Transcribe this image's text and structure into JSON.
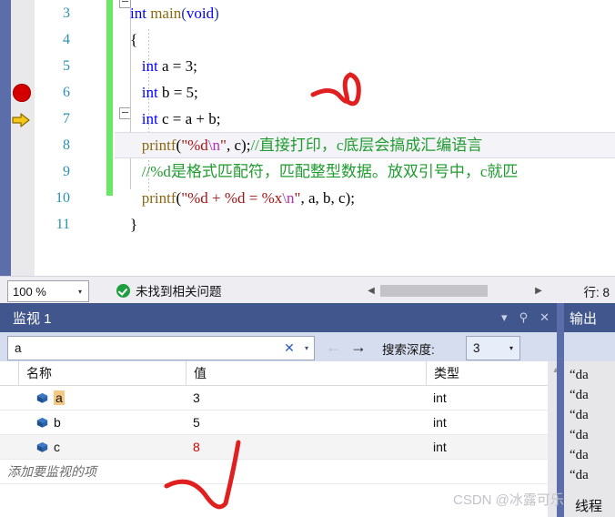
{
  "editor": {
    "line_numbers": [
      "3",
      "4",
      "5",
      "6",
      "7",
      "8",
      "9",
      "10",
      "11"
    ],
    "code_lines": [
      {
        "n": "3",
        "text": "int main(void)"
      },
      {
        "n": "4",
        "text": "{"
      },
      {
        "n": "5",
        "text": "    int a = 3;"
      },
      {
        "n": "6",
        "text": "    int b = 5;"
      },
      {
        "n": "7",
        "text": "    int c = a + b;"
      },
      {
        "n": "8",
        "text": "    printf(\"%d\\n\", c);//直接打印，c底层会搞成汇编语言"
      },
      {
        "n": "9",
        "text": "    //%d是格式匹配符，匹配整型数据。放双引号中，c就匹"
      },
      {
        "n": "10",
        "text": "    printf(\"%d + %d = %x\\n\", a, b, c);"
      },
      {
        "n": "11",
        "text": "}"
      }
    ],
    "breakpoint_line": "7",
    "current_line": "8",
    "colors": {
      "keyword": "#0000ff",
      "function": "#8b6914",
      "string": "#a31515",
      "escape": "#b030b0",
      "comment": "#1f9b2f",
      "linenumber": "#2b91af",
      "changebar": "#67e867",
      "breakpoint": "#d40000"
    }
  },
  "statusbar": {
    "zoom": "100 %",
    "zoom_caret": "▾",
    "problem_status": "未找到相关问题",
    "scroll_left": "◀",
    "scroll_right": "▶",
    "line_indicator": "行: 8"
  },
  "watch": {
    "title": "监视 1",
    "window_buttons": [
      "▾",
      "⚲",
      "✕"
    ],
    "search": {
      "value": "a",
      "clear": "✕",
      "caret": "▾"
    },
    "nav_back": "←",
    "nav_forward": "→",
    "depth_label": "搜索深度:",
    "depth_value": "3",
    "depth_caret": "▾",
    "columns": [
      "名称",
      "值",
      "类型"
    ],
    "rows": [
      {
        "name": "a",
        "value": "3",
        "type": "int",
        "value_changed": false,
        "name_highlight": true
      },
      {
        "name": "b",
        "value": "5",
        "type": "int",
        "value_changed": false,
        "name_highlight": false
      },
      {
        "name": "c",
        "value": "8",
        "type": "int",
        "value_changed": true,
        "name_highlight": false
      }
    ],
    "add_placeholder": "添加要监视的项",
    "scroll_up": "▲"
  },
  "output": {
    "title": "输出",
    "lines": [
      "“da",
      "“da",
      "“da",
      "“da",
      "“da",
      "“da"
    ],
    "thread_label": "线程"
  },
  "watermark": "CSDN @冰露可乐"
}
